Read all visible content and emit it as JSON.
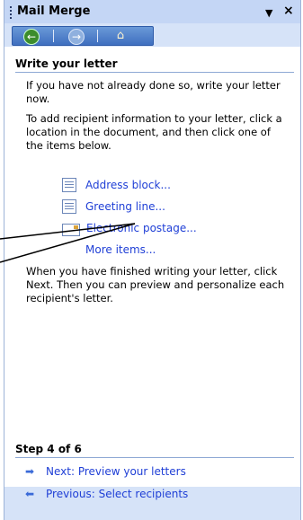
{
  "pane": {
    "title": "Mail Merge",
    "dropdown_icon": "dropdown-arrow-icon",
    "close_icon": "close-icon",
    "nav": {
      "back_icon": "back-arrow-icon",
      "forward_icon": "forward-arrow-icon",
      "home_icon": "home-icon"
    }
  },
  "section": {
    "heading": "Write your letter",
    "para1": "If you have not already done so, write your letter now.",
    "para2": "To add recipient information to your letter, click a location in the document, and then click one of the items below.",
    "items": [
      {
        "label": "Address block...",
        "icon": "address-block-icon"
      },
      {
        "label": "Greeting line...",
        "icon": "greeting-line-icon"
      },
      {
        "label": "Electronic postage...",
        "icon": "electronic-postage-icon"
      },
      {
        "label": "More items..."
      }
    ],
    "para3": "When you have finished writing your letter, click Next. Then you can preview and personalize each recipient's letter."
  },
  "footer": {
    "step": "Step 4 of 6",
    "next": "Next: Preview your letters",
    "previous": "Previous: Select recipients"
  },
  "colors": {
    "pane_bg": "#d6e3f8",
    "link": "#1f3fd6",
    "nav_bar": "#3f6fbf"
  }
}
